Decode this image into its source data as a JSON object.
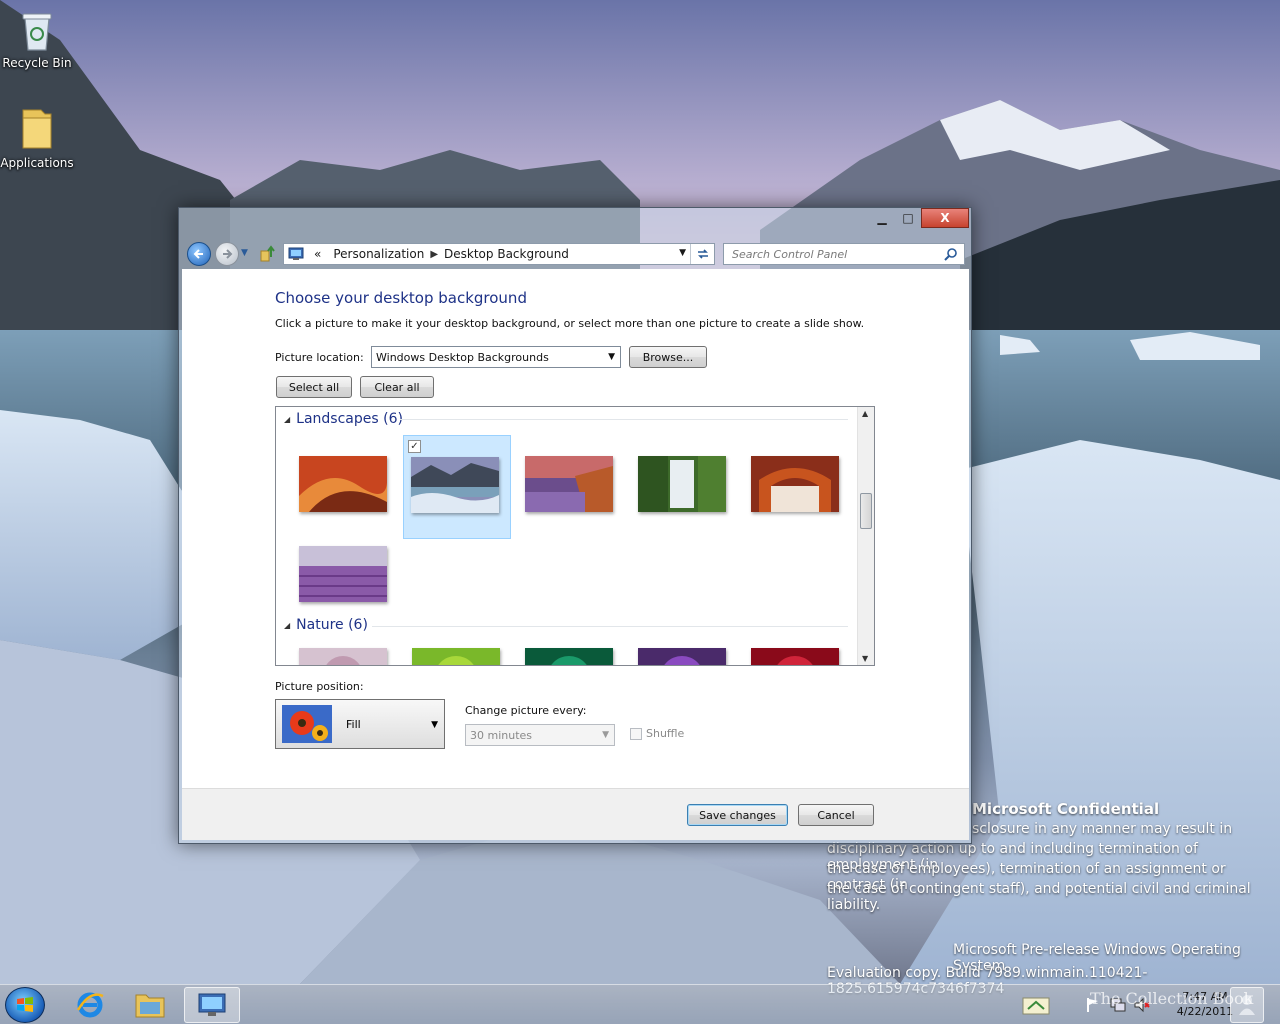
{
  "desktop": {
    "icons": [
      {
        "label": "Recycle Bin"
      },
      {
        "label": "Applications"
      }
    ]
  },
  "window": {
    "controls": {
      "minimize": "▁",
      "maximize": "□",
      "close": "X"
    },
    "address": {
      "overflow": "«",
      "segments": [
        "Personalization",
        "Desktop Background"
      ]
    },
    "search": {
      "placeholder": "Search Control Panel"
    },
    "heading": "Choose your desktop background",
    "subtext": "Click a picture to make it your desktop background, or select more than one picture to create a slide show.",
    "picture_location": {
      "label": "Picture location:",
      "value": "Windows Desktop Backgrounds",
      "browse": "Browse..."
    },
    "select_all": "Select all",
    "clear_all": "Clear all",
    "groups": [
      {
        "title": "Landscapes (6)",
        "selected_index": 1
      },
      {
        "title": "Nature (6)"
      }
    ],
    "picture_position": {
      "label": "Picture position:",
      "value": "Fill"
    },
    "change_every": {
      "label": "Change picture every:",
      "value": "30 minutes"
    },
    "shuffle": {
      "label": "Shuffle",
      "checked": false
    },
    "save": "Save changes",
    "cancel": "Cancel"
  },
  "watermark": {
    "title": "Microsoft Confidential",
    "lines": [
      "sclosure in any manner may result in",
      "disciplinary action up to and including termination of employment (in",
      "the case of employees), termination of an assignment or contract (in",
      "the case of contingent staff), and potential civil and criminal liability."
    ],
    "os": "Microsoft Pre-release Windows Operating System",
    "build": "Evaluation copy. Build 7989.winmain.110421-1825.615974c7346f7374"
  },
  "taskbar": {
    "time": "7:47 AM",
    "date": "4/22/2011",
    "brand": "The Collection Book"
  },
  "colors": {
    "accent": "#1e3287",
    "selection": "#cce8ff",
    "close": "#c7432f"
  }
}
